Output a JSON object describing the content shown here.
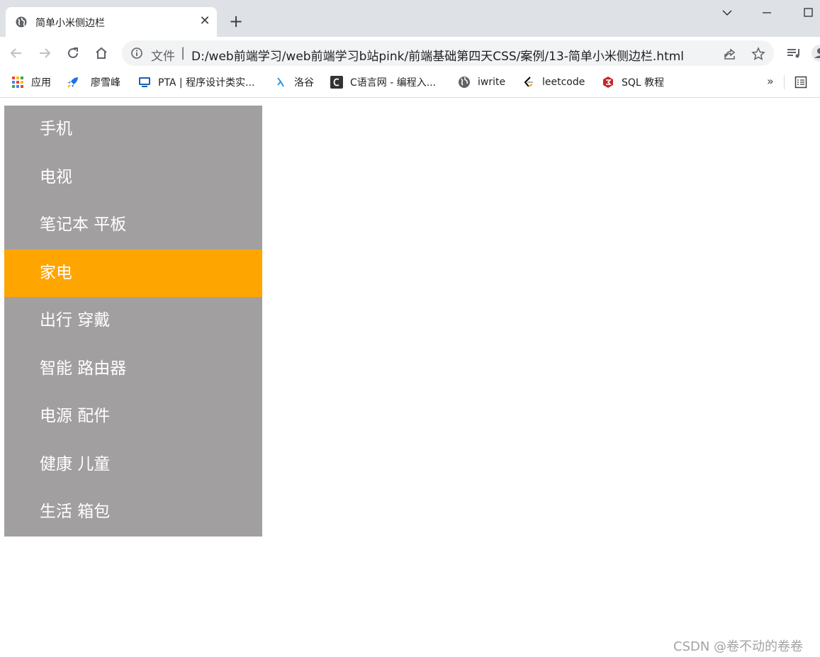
{
  "tab": {
    "title": "简单小米侧边栏",
    "close": "✕",
    "new_tab": "+"
  },
  "omnibox": {
    "scheme_label": "文件",
    "separator": "|",
    "url": "D:/web前端学习/web前端学习b站pink/前端基础第四天CSS/案例/13-简单小米侧边栏.html"
  },
  "bookmarks": [
    {
      "label": "应用",
      "icon": "apps-grid-icon"
    },
    {
      "label": "廖雪峰",
      "icon": "rocket-icon"
    },
    {
      "label": "PTA | 程序设计类实...",
      "icon": "pta-icon"
    },
    {
      "label": "洛谷",
      "icon": "luogu-icon"
    },
    {
      "label": "C语言网 - 编程入...",
      "icon": "c-lang-icon"
    },
    {
      "label": "iwrite",
      "icon": "globe-icon"
    },
    {
      "label": "leetcode",
      "icon": "leetcode-icon"
    },
    {
      "label": "SQL 教程",
      "icon": "sql-icon"
    }
  ],
  "bookmarks_more": "»",
  "sidebar": {
    "items": [
      {
        "label": "手机",
        "active": false
      },
      {
        "label": "电视",
        "active": false
      },
      {
        "label": "笔记本 平板",
        "active": false
      },
      {
        "label": "家电",
        "active": true
      },
      {
        "label": "出行 穿戴",
        "active": false
      },
      {
        "label": "智能 路由器",
        "active": false
      },
      {
        "label": "电源 配件",
        "active": false
      },
      {
        "label": "健康 儿童",
        "active": false
      },
      {
        "label": "生活 箱包",
        "active": false
      }
    ],
    "colors": {
      "background": "#a29fa0",
      "active": "#ffa500",
      "text": "#ffffff"
    }
  },
  "watermark": "CSDN @卷不动的卷卷"
}
